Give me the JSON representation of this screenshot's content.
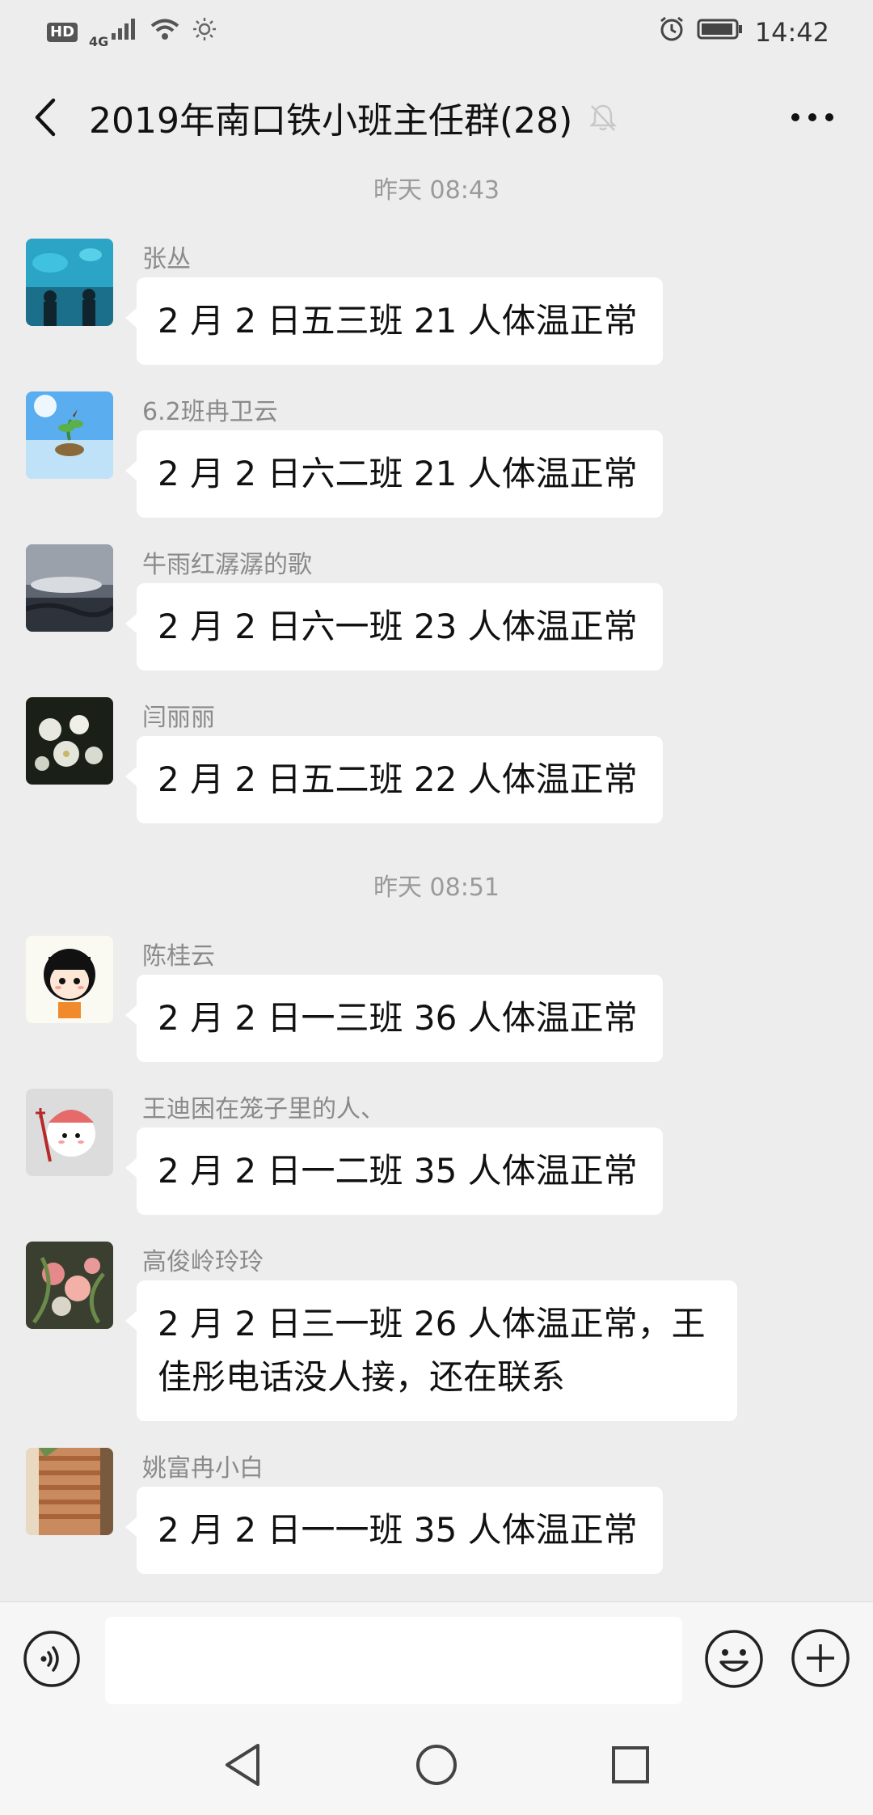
{
  "status_bar": {
    "hd": "HD",
    "net": "4G",
    "time": "14:42"
  },
  "header": {
    "title": "2019年南口铁小班主任群(28)"
  },
  "timestamps": [
    "昨天 08:43",
    "昨天 08:51"
  ],
  "messages": [
    {
      "sender": "张丛",
      "text": "2 月 2 日五三班 21 人体温正常"
    },
    {
      "sender": "6.2班冉卫云",
      "text": "2 月 2 日六二班 21 人体温正常"
    },
    {
      "sender": "牛雨红潺潺的歌",
      "text": "2 月 2 日六一班 23 人体温正常"
    },
    {
      "sender": "闫丽丽",
      "text": "2 月 2 日五二班 22 人体温正常"
    },
    {
      "sender": "陈桂云",
      "text": "2 月 2 日一三班 36 人体温正常"
    },
    {
      "sender": "王迪困在笼子里的人、",
      "text": "2 月 2 日一二班 35 人体温正常"
    },
    {
      "sender": "高俊岭玲玲",
      "text": "2 月 2 日三一班 26 人体温正常，王佳彤电话没人接，还在联系"
    },
    {
      "sender": "姚富冉小白",
      "text": "2 月 2 日一一班 35 人体温正常"
    }
  ],
  "input": {
    "value": ""
  }
}
